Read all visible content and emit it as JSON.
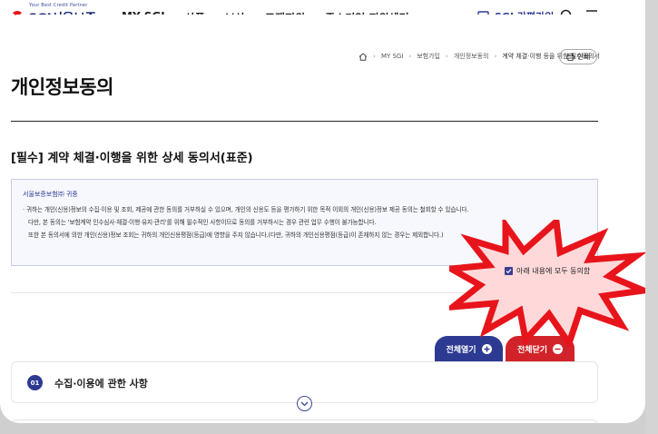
{
  "header": {
    "logo_tagline": "Your Best Credit Partner",
    "logo_name": "SGI서울보증",
    "nav": [
      "MY SGI",
      "상품",
      "보상",
      "고객지원",
      "중소기업 지원센터"
    ],
    "easy_join": "SGI 간편가입"
  },
  "breadcrumb": {
    "items": [
      "MY SGI",
      "보험가입",
      "개인정보동의"
    ],
    "current": "계약 체결·이행 등을 위한 필수동의서",
    "print_label": "인쇄"
  },
  "page_title": "개인정보동의",
  "section_title": "[필수] 계약 체결·이행을 위한 상세 동의서(표준)",
  "notice": {
    "title": "서울보증보험㈜ 귀중",
    "lines": [
      "· 귀하는 개인(신용)정보의 수집·이용 및 조회, 제공에 관한 동의를 거부하실 수 있으며, 개인의 신용도 등을 평가하기 위한 목적 이외의 개인(신용)정보 제공 동의는 철회할 수 있습니다.",
      "다만, 본 동의는 '보험계약 인수심사·체결·이행·유지·관리'를 위해 필수적인 사항이므로 동의를 거부하시는 경우 관련 업무 수행이 불가능합니다.",
      "또한 본 동의서에 의한 개인(신용)정보 조회는 귀하의 개인신용평점(등급)에 영향을 주지 않습니다.(다만, 귀하의 개인신용평점(등급)이 존재하지 않는 경우는 제외합니다.)"
    ]
  },
  "agree_all": {
    "label": "아래 내용에 모두 동의함",
    "checked": true
  },
  "buttons": {
    "open_all": "전체열기",
    "close_all": "전체닫기"
  },
  "accordion": [
    {
      "num": "01",
      "title": "수집·이용에 관한 사항"
    }
  ],
  "colors": {
    "brand": "#2d3a92",
    "accent_red": "#d2232a",
    "burst_red": "#e8141b"
  },
  "icons": [
    "home-icon",
    "print-icon",
    "search-icon",
    "menu-icon",
    "plus-icon",
    "minus-icon",
    "chevron-down-icon",
    "checkbox-icon"
  ]
}
